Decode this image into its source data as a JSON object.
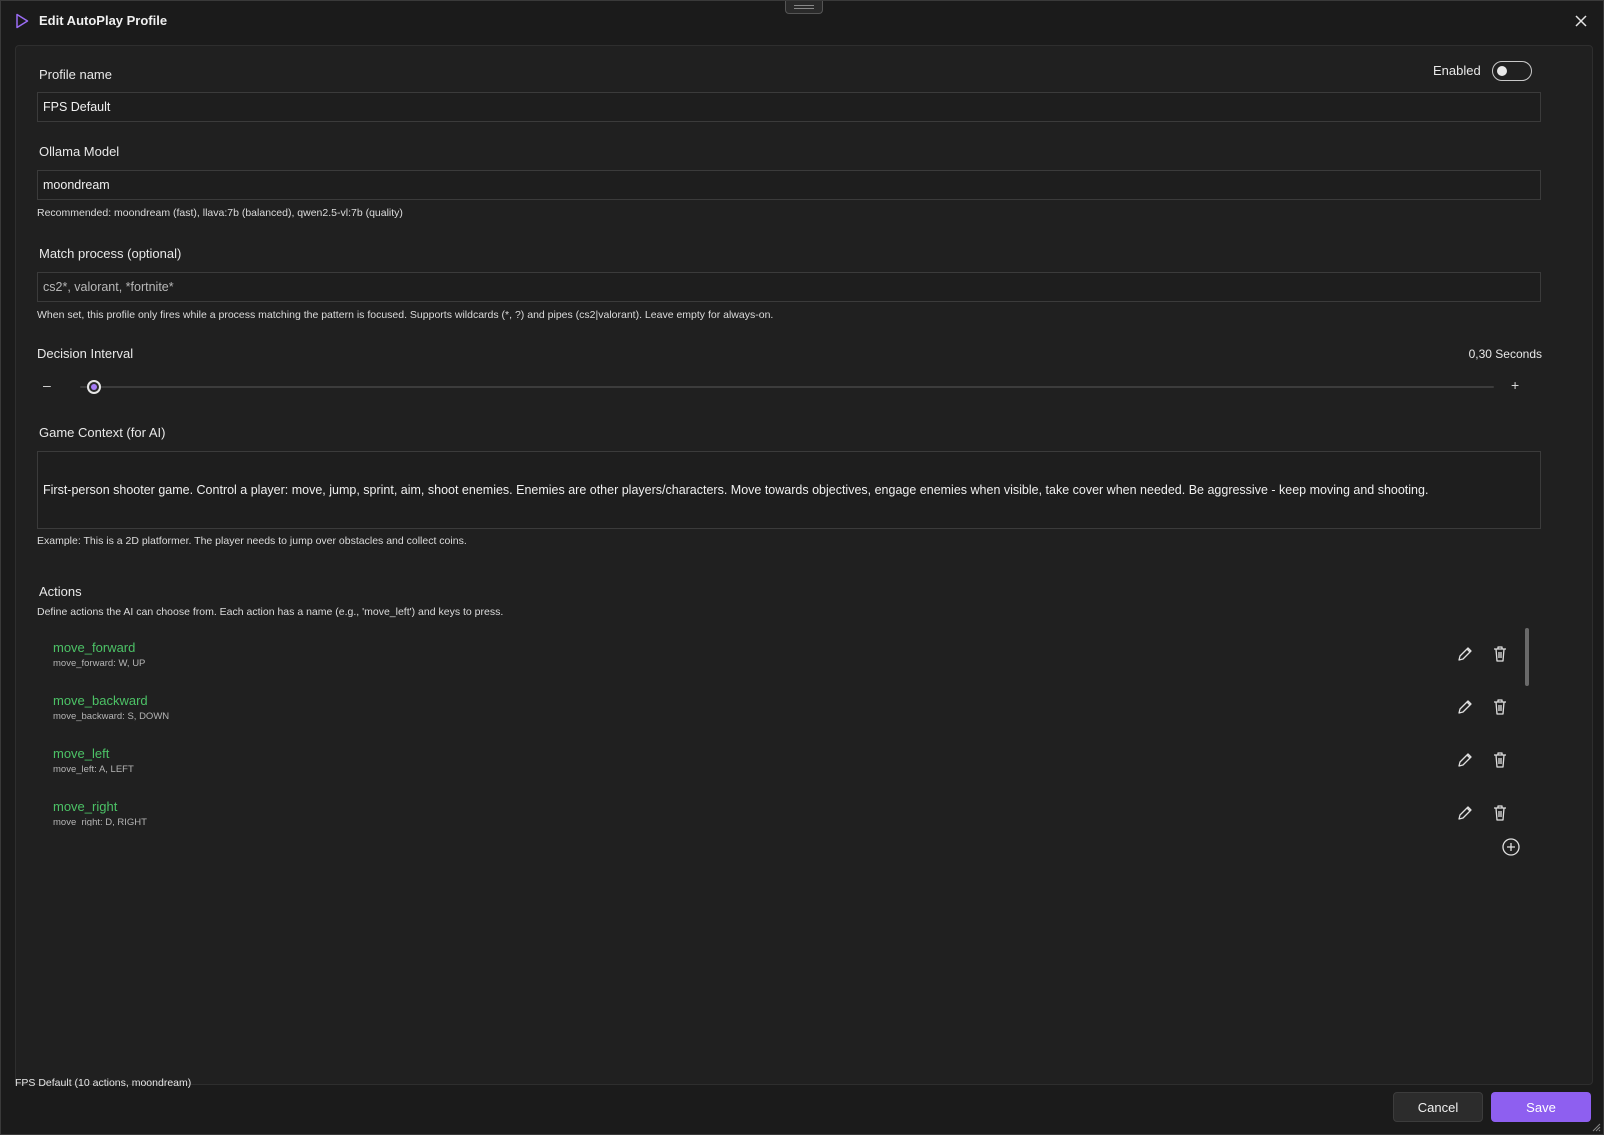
{
  "window": {
    "title": "Edit AutoPlay Profile"
  },
  "profile_name": {
    "label": "Profile name",
    "value": "FPS Default"
  },
  "enabled": {
    "label": "Enabled",
    "on": false
  },
  "model": {
    "label": "Ollama Model",
    "value": "moondream",
    "hint": "Recommended: moondream (fast), llava:7b (balanced), qwen2.5-vl:7b (quality)"
  },
  "match_process": {
    "label": "Match process (optional)",
    "placeholder": "cs2*, valorant, *fortnite*",
    "hint": "When set, this profile only fires while a process matching the pattern is focused. Supports wildcards (*, ?) and pipes (cs2|valorant). Leave empty for always-on."
  },
  "interval": {
    "label": "Decision Interval",
    "value_text": "0,30 Seconds",
    "fraction": 0.01,
    "minus": "–",
    "plus": "+"
  },
  "context": {
    "label": "Game Context (for AI)",
    "value": "First-person shooter game. Control a player: move, jump, sprint, aim, shoot enemies. Enemies are other players/characters. Move towards objectives, engage enemies when visible, take cover when needed. Be aggressive - keep moving and shooting.",
    "hint": "Example: This is a 2D platformer. The player needs to jump over obstacles and collect coins."
  },
  "actions": {
    "label": "Actions",
    "hint": "Define actions the AI can choose from. Each action has a name (e.g., 'move_left') and keys to press.",
    "items": [
      {
        "name": "move_forward",
        "keys": "move_forward: W, UP"
      },
      {
        "name": "move_backward",
        "keys": "move_backward: S, DOWN"
      },
      {
        "name": "move_left",
        "keys": "move_left: A, LEFT"
      },
      {
        "name": "move_right",
        "keys": "move_right: D, RIGHT"
      }
    ]
  },
  "footer": {
    "summary": "FPS Default (10 actions, moondream)",
    "cancel": "Cancel",
    "save": "Save"
  },
  "colors": {
    "accent": "#8e5ff0",
    "action_name": "#4cc266",
    "background": "#1b1b1b"
  },
  "icons": [
    "play-icon",
    "close-icon",
    "pencil-icon",
    "trash-icon",
    "add-circle-icon"
  ]
}
